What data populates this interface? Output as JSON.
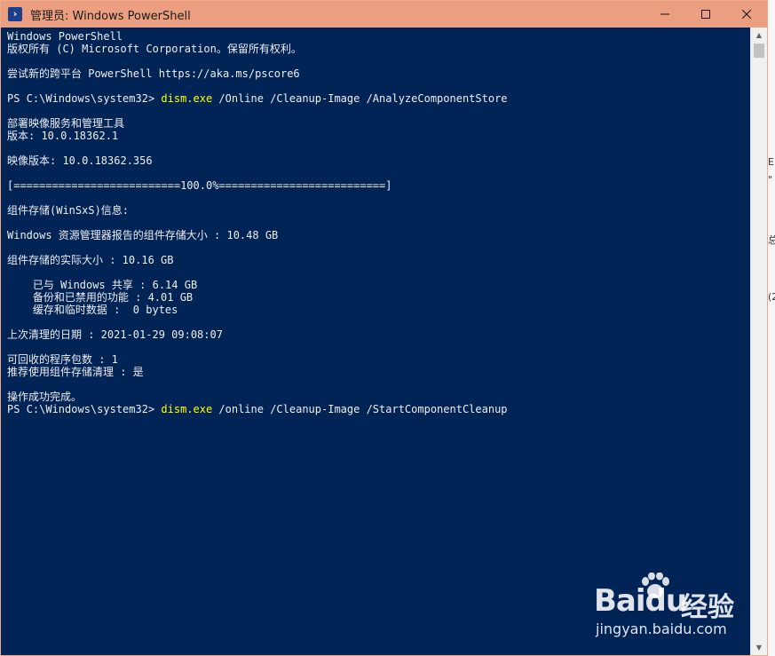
{
  "window": {
    "title": "管理员: Windows PowerShell",
    "controls": {
      "minimize": "—",
      "maximize": "☐",
      "close": "✕"
    }
  },
  "console": {
    "lines": [
      "Windows PowerShell",
      "版权所有 (C) Microsoft Corporation。保留所有权利。",
      "",
      "尝试新的跨平台 PowerShell https://aka.ms/pscore6",
      "",
      "__PROMPT1__",
      "",
      "部署映像服务和管理工具",
      "版本: 10.0.18362.1",
      "",
      "映像版本: 10.0.18362.356",
      "",
      "[==========================100.0%==========================]",
      "",
      "组件存储(WinSxS)信息:",
      "",
      "Windows 资源管理器报告的组件存储大小 : 10.48 GB",
      "",
      "组件存储的实际大小 : 10.16 GB",
      "",
      "    已与 Windows 共享 : 6.14 GB",
      "    备份和已禁用的功能 : 4.01 GB",
      "    缓存和临时数据 :  0 bytes",
      "",
      "上次清理的日期 : 2021-01-29 09:08:07",
      "",
      "可回收的程序包数 : 1",
      "推荐使用组件存储清理 : 是",
      "",
      "操作成功完成。",
      "__PROMPT2__"
    ],
    "prompt1": {
      "prompt": "PS C:\\Windows\\system32> ",
      "cmd": "dism.exe",
      "args": " /Online /Cleanup-Image /AnalyzeComponentStore"
    },
    "prompt2": {
      "prompt": "PS C:\\Windows\\system32> ",
      "cmd": "dism.exe",
      "args": " /online /Cleanup-Image /StartComponentCleanup"
    }
  },
  "watermark": {
    "logo": "Bai",
    "logo2": "du",
    "jingyan": "经验",
    "url": "jingyan.baidu.com"
  },
  "colors": {
    "console_bg": "#012456",
    "console_fg": "#eeedf0",
    "command": "#ffff00",
    "titlebar": "#ec9f80"
  }
}
